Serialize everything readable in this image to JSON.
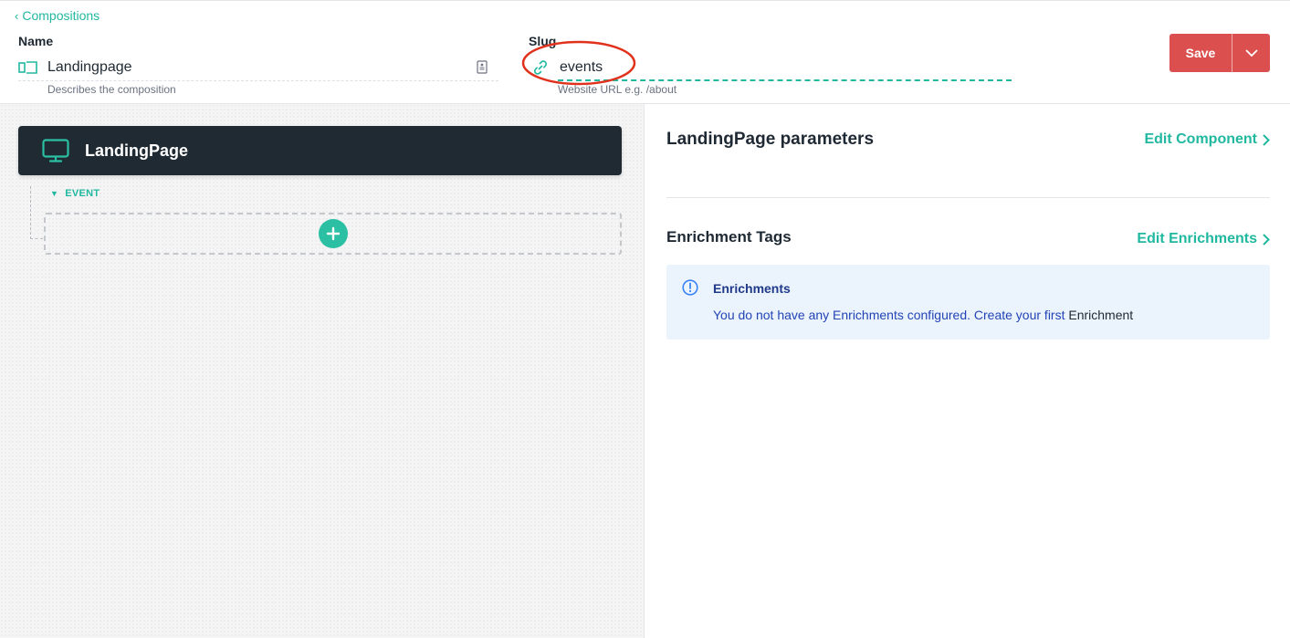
{
  "header": {
    "back_label": "Compositions",
    "name_label": "Name",
    "name_value": "Landingpage",
    "name_help": "Describes the composition",
    "slug_label": "Slug",
    "slug_value": "events",
    "slug_help": "Website URL e.g. /about",
    "save_label": "Save"
  },
  "canvas": {
    "component_title": "LandingPage",
    "slot_name": "EVENT"
  },
  "panel": {
    "params_title": "LandingPage parameters",
    "edit_component_label": "Edit Component",
    "enrichment_title": "Enrichment Tags",
    "edit_enrichments_label": "Edit Enrichments",
    "alert_title": "Enrichments",
    "alert_text_prefix": "You do not have any Enrichments configured. Create your first",
    "alert_text_suffix": "Enrichment"
  },
  "colors": {
    "accent": "#21b8a0",
    "save": "#dc4f4f",
    "card": "#1f2a33",
    "alert_bg": "#ebf3fc",
    "annotation": "#e0311c"
  },
  "icons": {
    "back": "chevron-left-icon",
    "name": "composition-icon",
    "doc": "document-icon",
    "slug": "link-icon",
    "dropdown": "chevron-down-icon",
    "monitor": "monitor-icon",
    "slot": "triangle-down-icon",
    "add": "plus-icon",
    "link_chevron": "chevron-right-icon",
    "info": "info-icon"
  }
}
